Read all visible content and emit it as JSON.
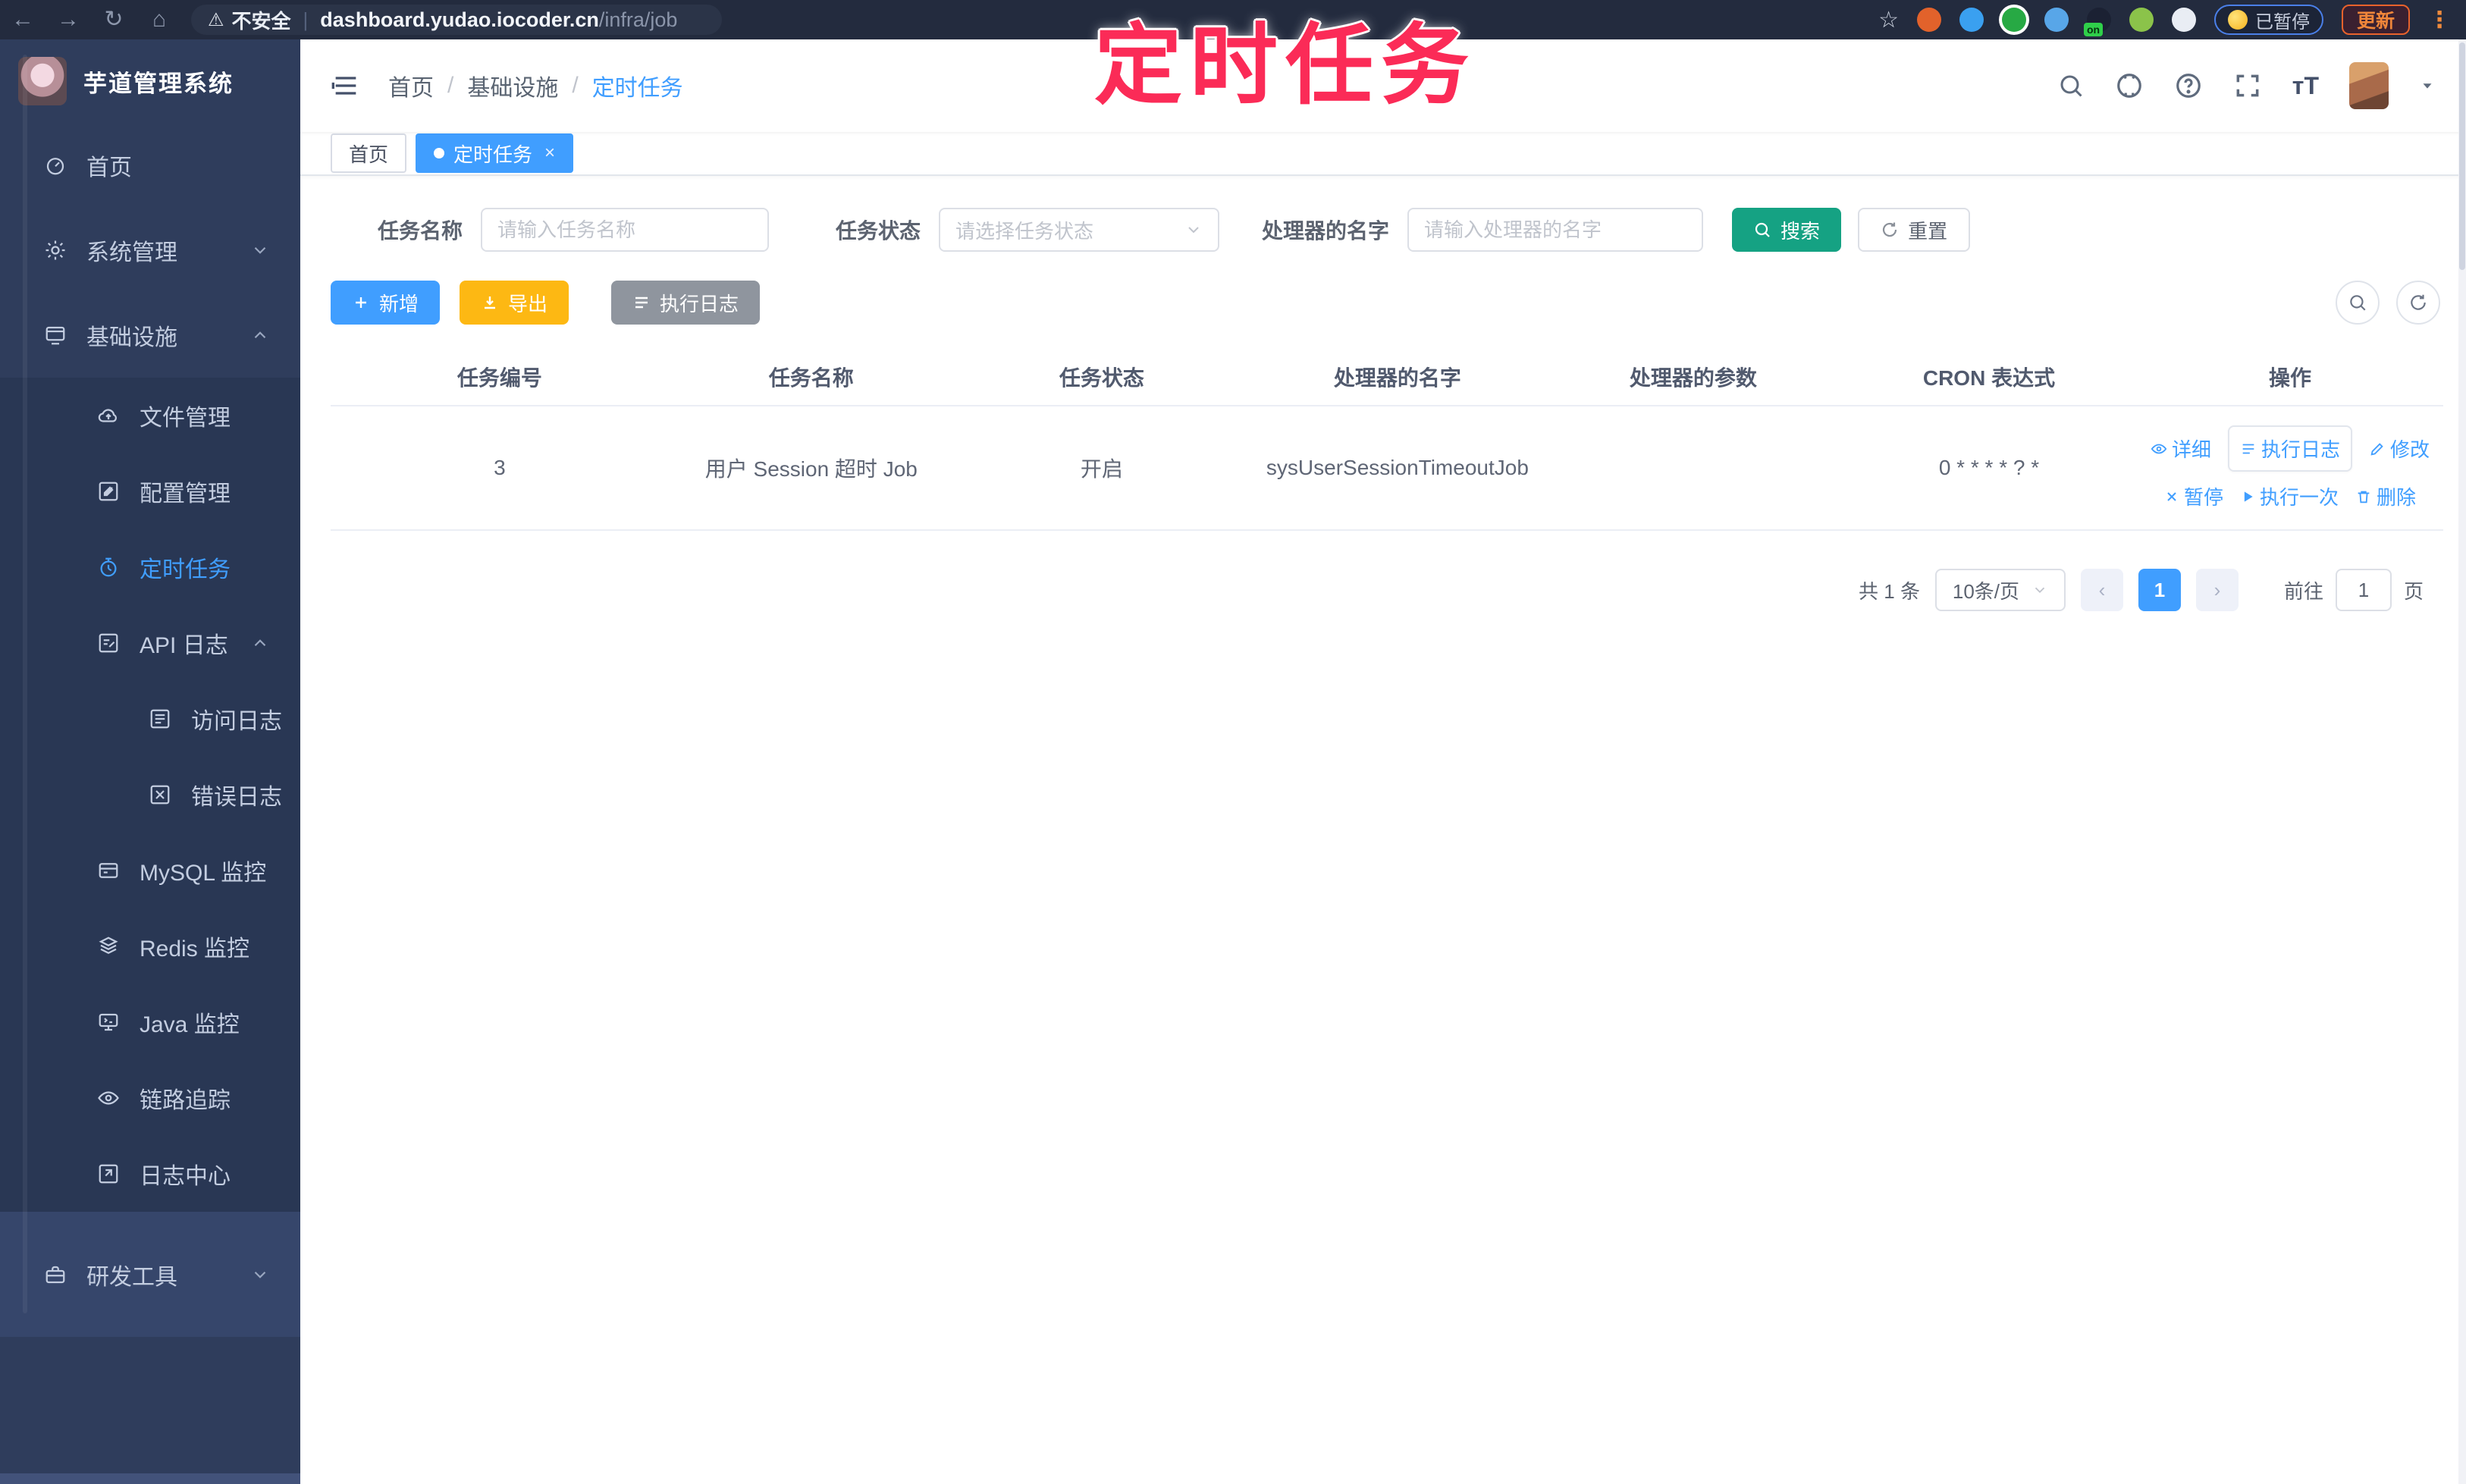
{
  "browser": {
    "security_label": "不安全",
    "url_host": "dashboard.yudao.iocoder.cn",
    "url_path": "/infra/job",
    "paused_badge": "已暂停",
    "update_label": "更新"
  },
  "overlay": {
    "title": "定时任务"
  },
  "sidebar": {
    "app_title": "芋道管理系统",
    "items": [
      {
        "label": "首页",
        "icon": "dashboard-icon"
      },
      {
        "label": "系统管理",
        "icon": "gear-icon"
      },
      {
        "label": "基础设施",
        "icon": "infra-icon"
      },
      {
        "label": "文件管理",
        "icon": "cloud-upload-icon"
      },
      {
        "label": "配置管理",
        "icon": "config-icon"
      },
      {
        "label": "定时任务",
        "icon": "timer-icon"
      },
      {
        "label": "API 日志",
        "icon": "api-log-icon"
      },
      {
        "label": "访问日志",
        "icon": "access-log-icon"
      },
      {
        "label": "错误日志",
        "icon": "error-log-icon"
      },
      {
        "label": "MySQL 监控",
        "icon": "mysql-icon"
      },
      {
        "label": "Redis 监控",
        "icon": "redis-icon"
      },
      {
        "label": "Java 监控",
        "icon": "java-icon"
      },
      {
        "label": "链路追踪",
        "icon": "trace-icon"
      },
      {
        "label": "日志中心",
        "icon": "log-center-icon"
      },
      {
        "label": "研发工具",
        "icon": "devtool-icon"
      }
    ]
  },
  "breadcrumb": {
    "items": [
      "首页",
      "基础设施",
      "定时任务"
    ],
    "separator": "/"
  },
  "tabs": [
    {
      "label": "首页"
    },
    {
      "label": "定时任务"
    }
  ],
  "filters": {
    "name_label": "任务名称",
    "name_placeholder": "请输入任务名称",
    "status_label": "任务状态",
    "status_placeholder": "请选择任务状态",
    "handler_label": "处理器的名字",
    "handler_placeholder": "请输入处理器的名字",
    "search_label": "搜索",
    "reset_label": "重置"
  },
  "toolbar": {
    "add_label": "新增",
    "export_label": "导出",
    "exec_log_label": "执行日志"
  },
  "table": {
    "columns": [
      "任务编号",
      "任务名称",
      "任务状态",
      "处理器的名字",
      "处理器的参数",
      "CRON 表达式",
      "操作"
    ],
    "rows": [
      {
        "id": "3",
        "name": "用户 Session 超时 Job",
        "status": "开启",
        "handler": "sysUserSessionTimeoutJob",
        "param": "",
        "cron": "0 * * * * ? *",
        "actions": [
          {
            "label": "详细"
          },
          {
            "label": "执行日志"
          },
          {
            "label": "修改"
          },
          {
            "label": "暂停"
          },
          {
            "label": "执行一次"
          },
          {
            "label": "删除"
          }
        ]
      }
    ]
  },
  "pagination": {
    "total": "共 1 条",
    "page_size": "10条/页",
    "page": "1",
    "prev": "‹",
    "next": "›",
    "goto_label": "前往",
    "goto_value": "1",
    "unit_label": "页"
  },
  "colors": {
    "accent": "#409eff",
    "search_teal": "#15a283",
    "export_orange": "#fdb813",
    "gray_button": "#8f959e",
    "overlay_pink": "#fb2b57",
    "sidebar_bg": "#2f3d5c"
  }
}
